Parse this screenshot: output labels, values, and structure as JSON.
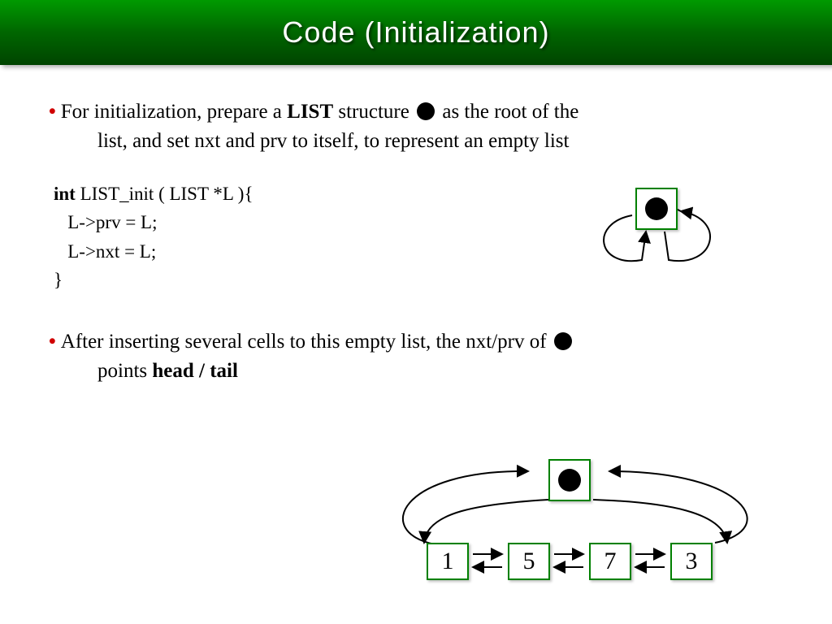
{
  "slide": {
    "title": "Code (Initialization)"
  },
  "bullet1": {
    "part1": "For initialization, prepare a ",
    "bold1": "LIST",
    "part2": " structure ",
    "part3": " as the root of the",
    "line2": "list, and set nxt and prv to itself, to represent an empty list"
  },
  "code": {
    "sig_kw": "int",
    "sig_rest": " LIST_init ( LIST *L ){",
    "l2": "   L->prv = L;",
    "l3": "   L->nxt = L;",
    "l4": "}"
  },
  "bullet2": {
    "part1": "After inserting several cells to this empty list, the nxt/prv of ",
    "part2": "",
    "line2a": "points ",
    "bold1": "head / tail"
  },
  "diagram2": {
    "cells": [
      "1",
      "5",
      "7",
      "3"
    ]
  }
}
